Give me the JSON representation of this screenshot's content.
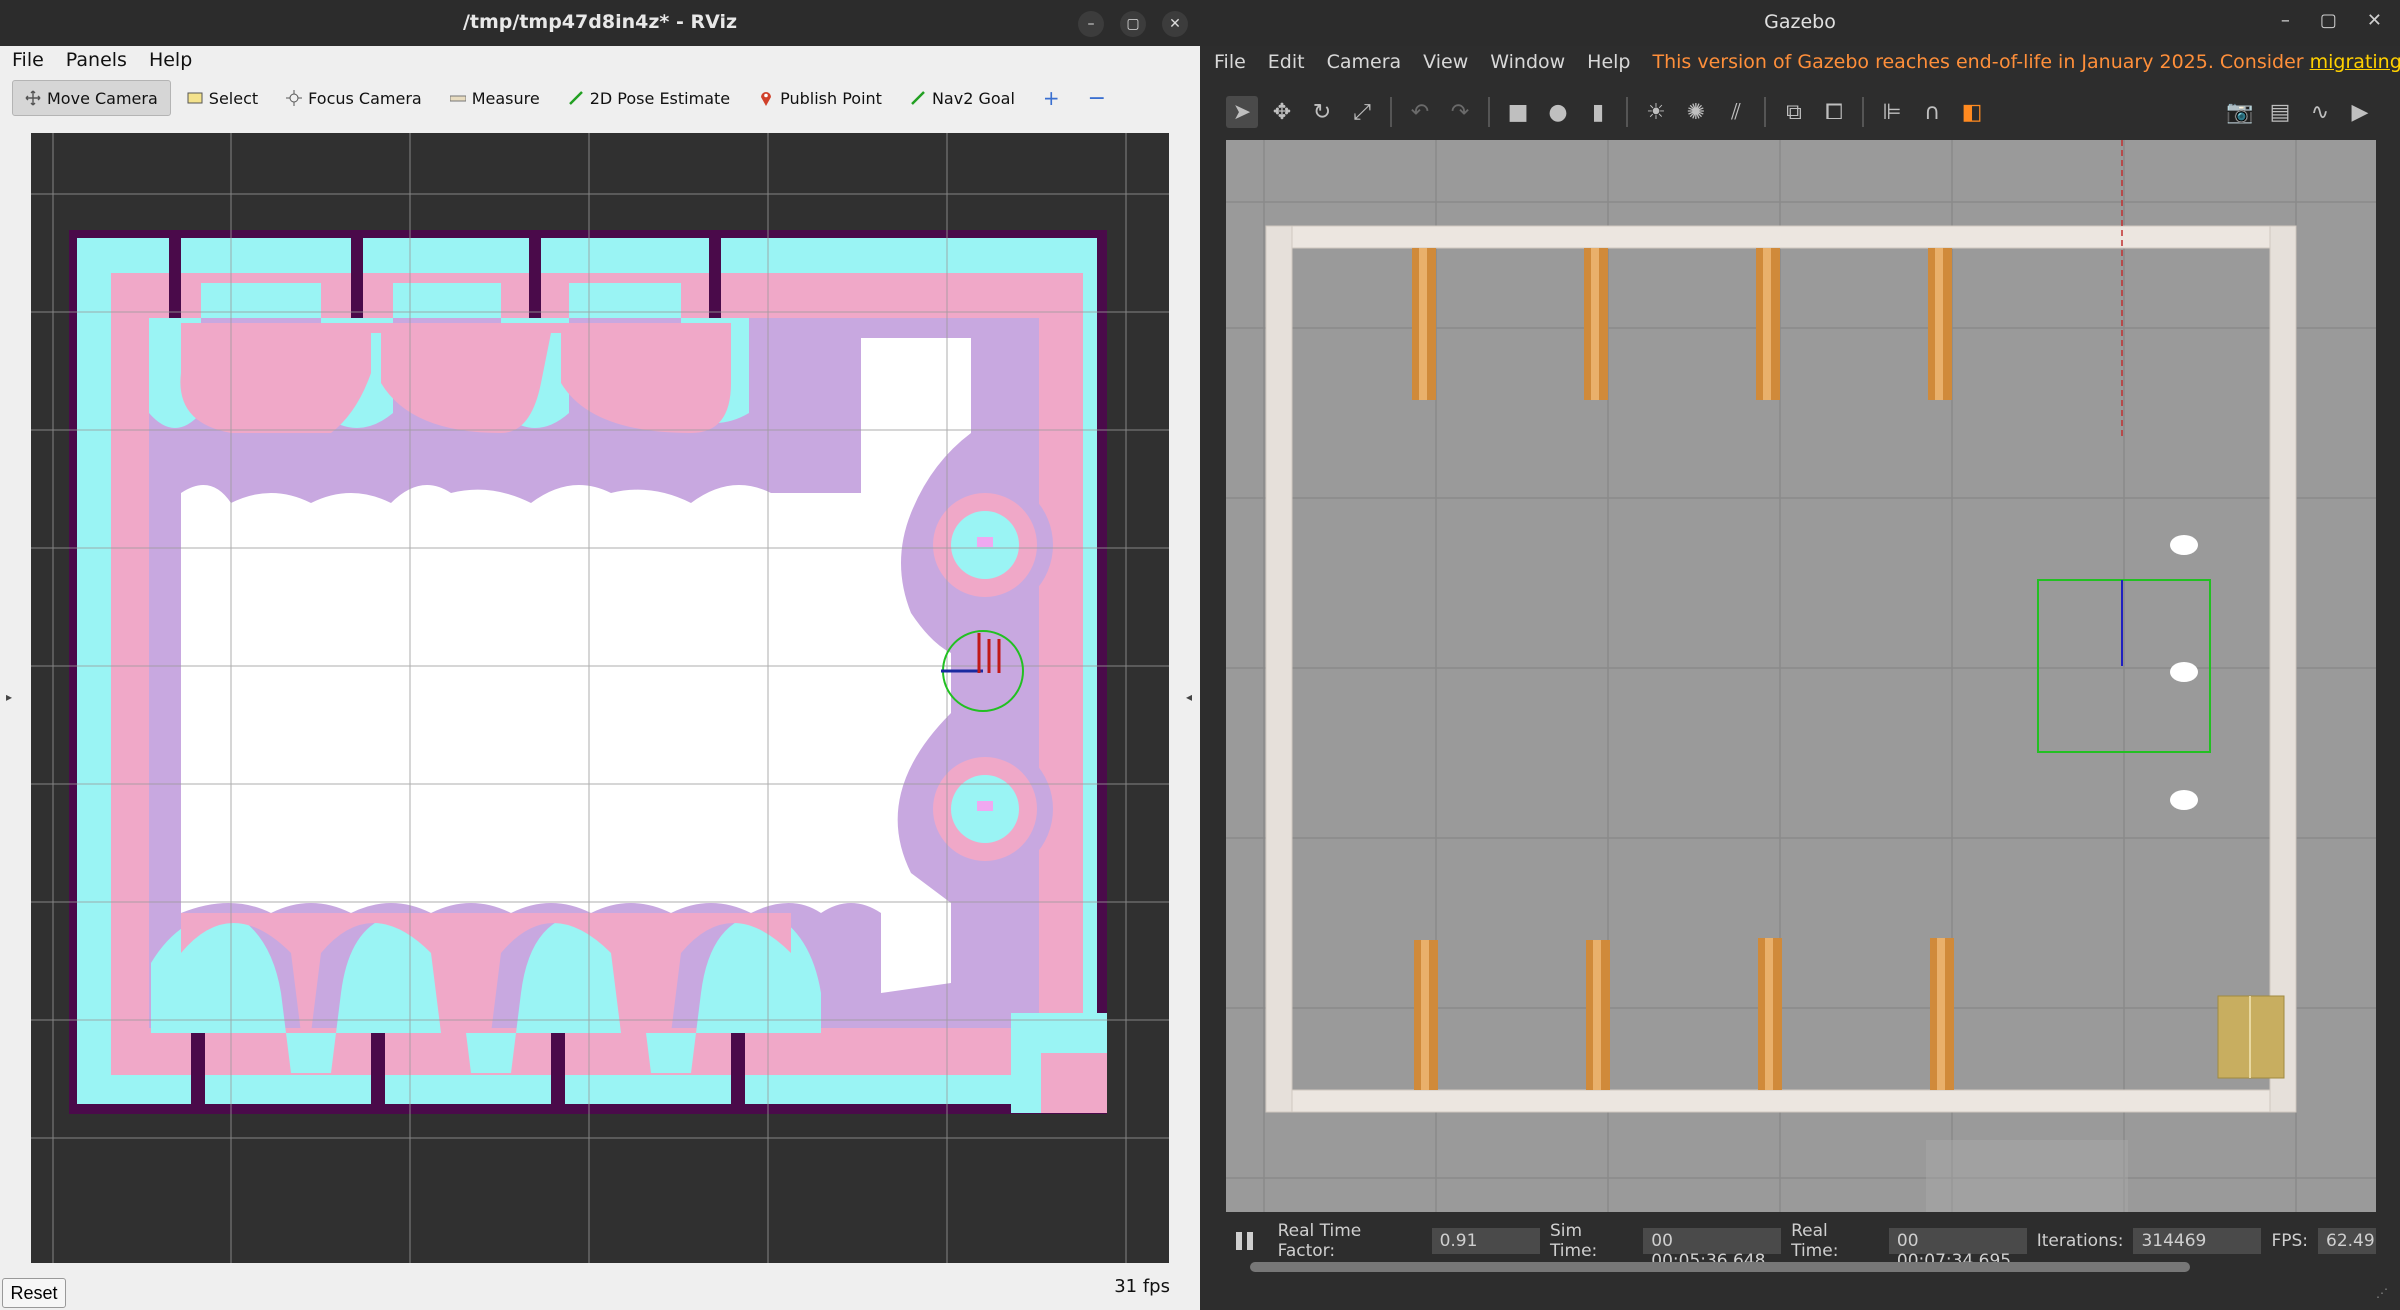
{
  "rviz": {
    "title": "/tmp/tmp47d8in4z* - RViz",
    "menu": [
      "File",
      "Panels",
      "Help"
    ],
    "tools": [
      {
        "label": "Move Camera",
        "icon": "move-camera-icon",
        "active": true
      },
      {
        "label": "Select",
        "icon": "select-icon"
      },
      {
        "label": "Focus Camera",
        "icon": "focus-camera-icon"
      },
      {
        "label": "Measure",
        "icon": "measure-icon"
      },
      {
        "label": "2D Pose Estimate",
        "icon": "pose-arrow-icon"
      },
      {
        "label": "Publish Point",
        "icon": "pin-icon"
      },
      {
        "label": "Nav2 Goal",
        "icon": "goal-arrow-icon"
      }
    ],
    "reset_label": "Reset",
    "fps": "31 fps",
    "colors": {
      "costmap_lethal": "#4a0a4a",
      "costmap_inscribed": "#9af4f4",
      "costmap_inflated": "#f0a8c8",
      "costmap_gradient": "#c8a8e0",
      "free": "#ffffff",
      "grid": "#9a9a9a",
      "robot_footprint": "#22c022"
    }
  },
  "gazebo": {
    "title": "Gazebo",
    "menu": [
      "File",
      "Edit",
      "Camera",
      "View",
      "Window",
      "Help"
    ],
    "warning_text": "This version of Gazebo reaches end-of-life in January 2025. Consider",
    "warning_link": "migrating to the new G",
    "status": {
      "rtf_label": "Real Time Factor:",
      "rtf_value": "0.91",
      "sim_label": "Sim Time:",
      "sim_value": "00 00:05:36.648",
      "real_label": "Real Time:",
      "real_value": "00 00:07:34.695",
      "iter_label": "Iterations:",
      "iter_value": "314469",
      "fps_label": "FPS:",
      "fps_value": "62.49"
    },
    "colors": {
      "ground": "#9a9a9a",
      "wall": "#e8e2dc",
      "pillar": "#d08a3a",
      "selection_box": "#22c022",
      "box": "#c8ae60"
    }
  }
}
